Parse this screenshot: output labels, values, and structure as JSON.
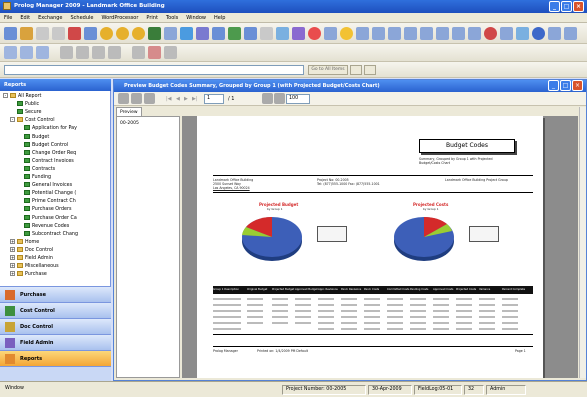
{
  "window": {
    "title": "Prolog Manager 2009 - Landmark Office Building"
  },
  "menu": [
    "File",
    "Edit",
    "Exchange",
    "Schedule",
    "WordProcessor",
    "Print",
    "Tools",
    "Window",
    "Help"
  ],
  "address_bar": {
    "go_label": "Go to All Items",
    "value": ""
  },
  "left_panel": {
    "header": "Reports",
    "tree": [
      {
        "label": "All Report",
        "level": 0,
        "kind": "folder",
        "exp": "-"
      },
      {
        "label": "Public",
        "level": 2,
        "kind": "report"
      },
      {
        "label": "Secure",
        "level": 2,
        "kind": "report"
      },
      {
        "label": "Cost Control",
        "level": 1,
        "kind": "folder",
        "exp": "-"
      },
      {
        "label": "Application for Pay",
        "level": 3,
        "kind": "report"
      },
      {
        "label": "Budget",
        "level": 3,
        "kind": "report"
      },
      {
        "label": "Budget Control",
        "level": 3,
        "kind": "report"
      },
      {
        "label": "Change Order Req",
        "level": 3,
        "kind": "report"
      },
      {
        "label": "Contract Invoices",
        "level": 3,
        "kind": "report"
      },
      {
        "label": "Contracts",
        "level": 3,
        "kind": "report"
      },
      {
        "label": "Funding",
        "level": 3,
        "kind": "report"
      },
      {
        "label": "General Invoices",
        "level": 3,
        "kind": "report"
      },
      {
        "label": "Potential Change (",
        "level": 3,
        "kind": "report"
      },
      {
        "label": "Prime Contract Ch",
        "level": 3,
        "kind": "report"
      },
      {
        "label": "Purchase Orders",
        "level": 3,
        "kind": "report"
      },
      {
        "label": "Purchase Order Ca",
        "level": 3,
        "kind": "report"
      },
      {
        "label": "Revenue Codes",
        "level": 3,
        "kind": "report"
      },
      {
        "label": "Subcontract Chang",
        "level": 3,
        "kind": "report"
      },
      {
        "label": "Home",
        "level": 1,
        "kind": "folder",
        "exp": "+"
      },
      {
        "label": "Doc Control",
        "level": 1,
        "kind": "folder",
        "exp": "+"
      },
      {
        "label": "Field Admin",
        "level": 1,
        "kind": "folder",
        "exp": "+"
      },
      {
        "label": "Miscellaneous",
        "level": 1,
        "kind": "folder",
        "exp": "+"
      },
      {
        "label": "Purchase",
        "level": 1,
        "kind": "folder",
        "exp": "+"
      }
    ],
    "nav_buttons": [
      "Purchase",
      "Cost Control",
      "Doc Control",
      "Field Admin",
      "Reports"
    ]
  },
  "report_window": {
    "title": "Preview Budget Codes Summary, Grouped by Group 1 (with Projected Budget/Costs Chart)",
    "page_indicator": "1",
    "page_total": "/ 1",
    "zoom": "100",
    "tab_label": "Preview",
    "side_item": "00-2005"
  },
  "report_page": {
    "heading": "Budget Codes",
    "subheading_lines": [
      "Summary, Grouped by Group 1 with Projected",
      "Budget/Costs Chart"
    ],
    "company_lines": [
      "Landmark Office Building",
      "2500 Sunset Way",
      "Los Angeles, CA 90024"
    ],
    "company_link": "Landmark Office Building",
    "project_lines": [
      "Project No: 00-2005",
      "Tel: (877)555-1000    Fax: (877)555-1001"
    ],
    "right_header": "Landmark Office Building Project Group",
    "chart_left": {
      "title": "Projected Budget",
      "subtitle": "by Group 1"
    },
    "chart_right": {
      "title": "Projected Costs",
      "subtitle": "by Group 1"
    },
    "table_headers": [
      "Group 1   Description",
      "Original Budget",
      "Projected Budget",
      "Approved Budget",
      "Appr. Revisions",
      "Pend. Revisions",
      "Pend. Costs",
      "Committed Costs",
      "Pending Costs",
      "Approved Costs",
      "Projected Costs",
      "Variance",
      "Percent Complete"
    ],
    "footer_left": "Prolog Manager",
    "footer_mid": "Printed on: 1/4/2009        PM Default",
    "footer_right": "Page 1"
  },
  "statusbar": {
    "left": "Window",
    "project": "Project Number: 00-2005",
    "date": "30-Apr-2009",
    "fieldlog": "FieldLog:05-01",
    "num": "32",
    "user": "Admin"
  },
  "colors": {
    "title_bar": "#2a62cf",
    "pie_blue": "#3d5fb8",
    "pie_red": "#d42a2a",
    "pie_green": "#9acd32",
    "nav_active": "#f4a636"
  }
}
